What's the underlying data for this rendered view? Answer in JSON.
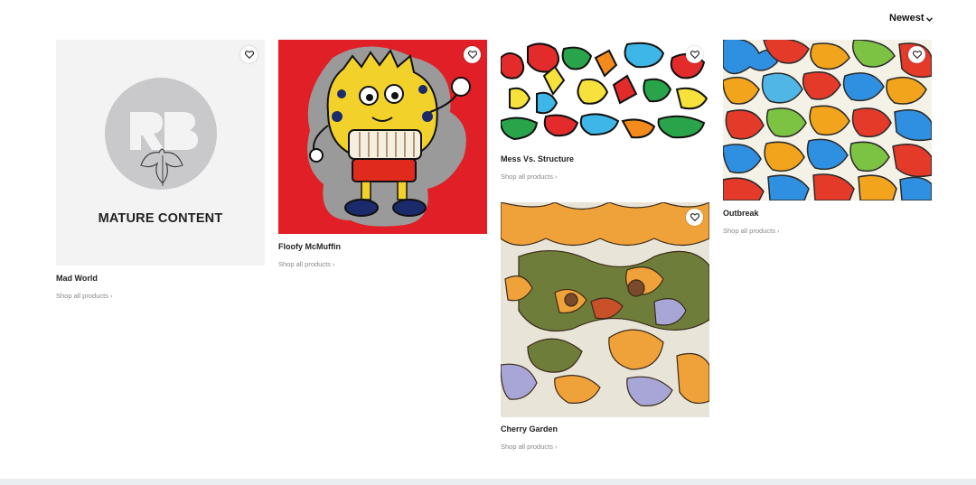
{
  "sort": {
    "label": "Newest",
    "icon": "chevron-down-icon"
  },
  "cards": [
    {
      "title": "Mad World",
      "link": "Shop all products",
      "mature_label": "MATURE CONTENT",
      "logo_text": "RB"
    },
    {
      "title": "Floofy McMuffin",
      "link": "Shop all products"
    },
    {
      "title": "Mess Vs. Structure",
      "link": "Shop all products"
    },
    {
      "title": "Outbreak",
      "link": "Shop all products"
    },
    {
      "title": "Cherry Garden",
      "link": "Shop all products"
    }
  ],
  "colors": {
    "red_bg": "#e01f26",
    "placeholder_bg": "#f3f3f4",
    "link_gray": "#888888",
    "footer_bar": "#ebeef0"
  }
}
